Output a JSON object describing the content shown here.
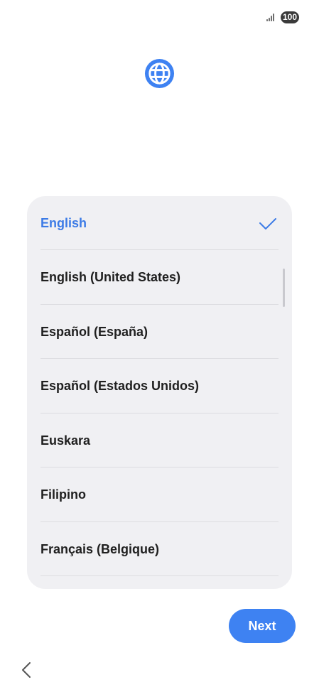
{
  "status_bar": {
    "signal_icon": "signal-bars-icon",
    "battery_level": "100"
  },
  "header": {
    "icon": "globe-icon",
    "accent_color": "#3e82f2"
  },
  "language_list": {
    "selected_color": "#3c7be6",
    "items": [
      {
        "label": "English",
        "selected": true,
        "icon": "checkmark-icon"
      },
      {
        "label": "English (United States)",
        "selected": false
      },
      {
        "label": "Español (España)",
        "selected": false
      },
      {
        "label": "Español (Estados Unidos)",
        "selected": false
      },
      {
        "label": "Euskara",
        "selected": false
      },
      {
        "label": "Filipino",
        "selected": false
      },
      {
        "label": "Français (Belgique)",
        "selected": false
      }
    ]
  },
  "footer": {
    "next_label": "Next",
    "back_icon": "chevron-left-icon"
  }
}
